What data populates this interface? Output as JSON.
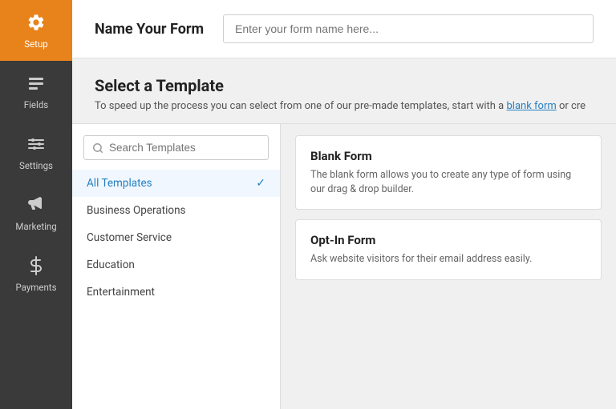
{
  "sidebar": {
    "items": [
      {
        "id": "setup",
        "label": "Setup",
        "active": true,
        "icon": "gear"
      },
      {
        "id": "fields",
        "label": "Fields",
        "active": false,
        "icon": "fields"
      },
      {
        "id": "settings",
        "label": "Settings",
        "active": false,
        "icon": "settings"
      },
      {
        "id": "marketing",
        "label": "Marketing",
        "active": false,
        "icon": "megaphone"
      },
      {
        "id": "payments",
        "label": "Payments",
        "active": false,
        "icon": "dollar"
      }
    ]
  },
  "formName": {
    "title": "Name Your Form",
    "placeholder": "Enter your form name here..."
  },
  "selectTemplate": {
    "title": "Select a Template",
    "description": "To speed up the process you can select from one of our pre-made templates, start with a",
    "linkText": "blank form",
    "descriptionSuffix": " or cre"
  },
  "search": {
    "placeholder": "Search Templates"
  },
  "categories": [
    {
      "id": "all",
      "label": "All Templates",
      "active": true
    },
    {
      "id": "business",
      "label": "Business Operations",
      "active": false
    },
    {
      "id": "customer",
      "label": "Customer Service",
      "active": false
    },
    {
      "id": "education",
      "label": "Education",
      "active": false
    },
    {
      "id": "entertainment",
      "label": "Entertainment",
      "active": false
    }
  ],
  "templates": [
    {
      "id": "blank",
      "title": "Blank Form",
      "description": "The blank form allows you to create any type of form using our drag & drop builder."
    },
    {
      "id": "optin",
      "title": "Opt-In Form",
      "description": "Ask website visitors for their email address easily."
    }
  ]
}
